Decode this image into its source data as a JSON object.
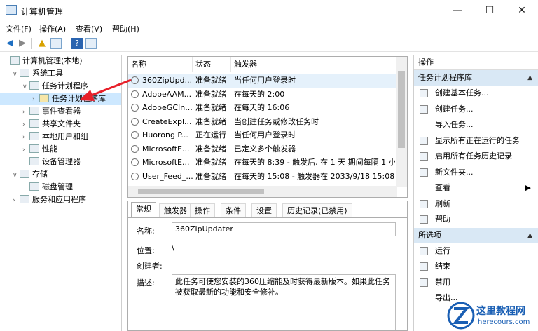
{
  "window": {
    "title": "计算机管理",
    "minimize": "—",
    "maximize": "☐",
    "close": "✕"
  },
  "menu": [
    "文件(F)",
    "操作(A)",
    "查看(V)",
    "帮助(H)"
  ],
  "tree": [
    {
      "label": "计算机管理(本地)",
      "indent": 0,
      "exp": ""
    },
    {
      "label": "系统工具",
      "indent": 1,
      "exp": "∨"
    },
    {
      "label": "任务计划程序",
      "indent": 2,
      "exp": "∨"
    },
    {
      "label": "任务计划程序库",
      "indent": 3,
      "exp": "›",
      "selected": true
    },
    {
      "label": "事件查看器",
      "indent": 2,
      "exp": "›"
    },
    {
      "label": "共享文件夹",
      "indent": 2,
      "exp": "›"
    },
    {
      "label": "本地用户和组",
      "indent": 2,
      "exp": "›"
    },
    {
      "label": "性能",
      "indent": 2,
      "exp": "›"
    },
    {
      "label": "设备管理器",
      "indent": 2,
      "exp": ""
    },
    {
      "label": "存储",
      "indent": 1,
      "exp": "∨"
    },
    {
      "label": "磁盘管理",
      "indent": 2,
      "exp": ""
    },
    {
      "label": "服务和应用程序",
      "indent": 1,
      "exp": "›"
    }
  ],
  "tasks": {
    "headers": [
      "名称",
      "状态",
      "触发器"
    ],
    "rows": [
      [
        "360ZipUpd...",
        "准备就绪",
        "当任何用户登录时"
      ],
      [
        "AdobeAAM...",
        "准备就绪",
        "在每天的 2:00"
      ],
      [
        "AdobeGCIn...",
        "准备就绪",
        "在每天的 16:06"
      ],
      [
        "CreateExpl...",
        "准备就绪",
        "当创建任务或修改任务时"
      ],
      [
        "Huorong P...",
        "正在运行",
        "当任何用户登录时"
      ],
      [
        "MicrosoftE...",
        "准备就绪",
        "已定义多个触发器"
      ],
      [
        "MicrosoftE...",
        "准备就绪",
        "在每天的 8:39 - 触发后, 在 1 天 期间每隔 1 小"
      ],
      [
        "User_Feed_...",
        "准备就绪",
        "在每天的 15:08 - 触发器在 2033/9/18 15:08:5"
      ]
    ]
  },
  "detail": {
    "tabs": [
      "常规",
      "触发器",
      "操作",
      "条件",
      "设置",
      "历史记录(已禁用)"
    ],
    "name_label": "名称:",
    "name_value": "360ZipUpdater",
    "location_label": "位置:",
    "location_value": "\\",
    "author_label": "创建者:",
    "desc_label": "描述:",
    "desc_value": "此任务可使您安装的360压缩能及时获得最新版本。如果此任务被获取最新的功能和安全修补。"
  },
  "actions": {
    "header": "操作",
    "section1": "任务计划程序库",
    "items1": [
      {
        "label": "创建基本任务...",
        "icon": "create-basic-task-icon"
      },
      {
        "label": "创建任务...",
        "icon": "create-task-icon"
      },
      {
        "label": "导入任务...",
        "icon": ""
      },
      {
        "label": "显示所有正在运行的任务",
        "icon": "running-tasks-icon"
      },
      {
        "label": "启用所有任务历史记录",
        "icon": "history-icon"
      },
      {
        "label": "新文件夹...",
        "icon": "folder-icon"
      },
      {
        "label": "查看",
        "icon": "",
        "arrow": true
      },
      {
        "label": "刷新",
        "icon": "refresh-icon"
      },
      {
        "label": "帮助",
        "icon": "help-icon"
      }
    ],
    "section2": "所选项",
    "items2": [
      {
        "label": "运行",
        "icon": "run-icon"
      },
      {
        "label": "结束",
        "icon": "stop-icon"
      },
      {
        "label": "禁用",
        "icon": "disable-icon"
      },
      {
        "label": "导出...",
        "icon": ""
      }
    ]
  },
  "watermark": {
    "text": "这里教程网",
    "url": "herecours.com"
  },
  "colors": {
    "accent": "#0063b1",
    "section": "#d9e8f5",
    "selected": "#cde8ff",
    "arrow": "#e8202a"
  }
}
